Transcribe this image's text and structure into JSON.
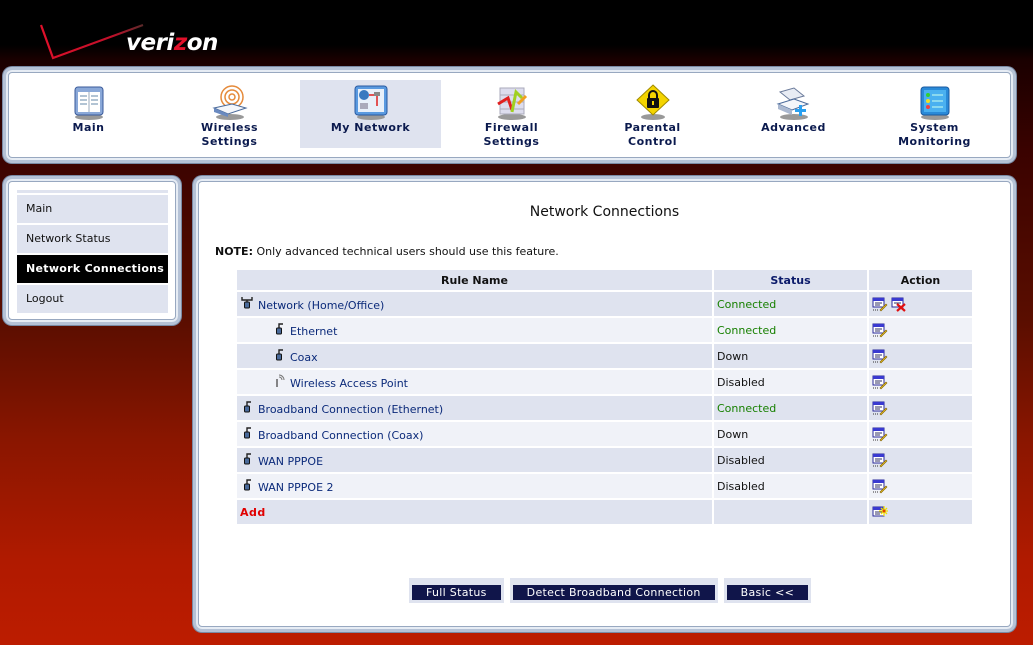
{
  "brand": {
    "logo_prefix": "veri",
    "logo_z": "z",
    "logo_suffix": "on"
  },
  "top_nav": [
    {
      "label_line1": "Main",
      "label_line2": "",
      "icon": "main-icon",
      "active": false
    },
    {
      "label_line1": "Wireless",
      "label_line2": "Settings",
      "icon": "wireless-icon",
      "active": false
    },
    {
      "label_line1": "My Network",
      "label_line2": "",
      "icon": "network-icon",
      "active": true
    },
    {
      "label_line1": "Firewall",
      "label_line2": "Settings",
      "icon": "firewall-icon",
      "active": false
    },
    {
      "label_line1": "Parental",
      "label_line2": "Control",
      "icon": "lock-icon",
      "active": false
    },
    {
      "label_line1": "Advanced",
      "label_line2": "",
      "icon": "advanced-icon",
      "active": false
    },
    {
      "label_line1": "System",
      "label_line2": "Monitoring",
      "icon": "monitoring-icon",
      "active": false
    }
  ],
  "sidebar": {
    "items": [
      {
        "label": "Main",
        "active": false
      },
      {
        "label": "Network Status",
        "active": false
      },
      {
        "label": "Network Connections",
        "active": true
      },
      {
        "label": "Logout",
        "active": false
      }
    ]
  },
  "main": {
    "title": "Network Connections",
    "note_label": "NOTE:",
    "note_text": " Only advanced technical users should use this feature.",
    "table": {
      "headers": {
        "name": "Rule Name",
        "status": "Status",
        "action": "Action"
      },
      "rows": [
        {
          "name": "Network (Home/Office)",
          "indent": false,
          "icon": "bridge-icon",
          "status": "Connected",
          "actions": [
            "edit",
            "delete"
          ]
        },
        {
          "name": "Ethernet",
          "indent": true,
          "icon": "ethernet-icon",
          "status": "Connected",
          "actions": [
            "edit"
          ]
        },
        {
          "name": "Coax",
          "indent": true,
          "icon": "ethernet-icon",
          "status": "Down",
          "actions": [
            "edit"
          ]
        },
        {
          "name": "Wireless Access Point",
          "indent": true,
          "icon": "wireless-ap-icon",
          "status": "Disabled",
          "actions": [
            "edit"
          ]
        },
        {
          "name": "Broadband Connection (Ethernet)",
          "indent": false,
          "icon": "ethernet-icon",
          "status": "Connected",
          "actions": [
            "edit"
          ]
        },
        {
          "name": "Broadband Connection (Coax)",
          "indent": false,
          "icon": "ethernet-icon",
          "status": "Down",
          "actions": [
            "edit"
          ]
        },
        {
          "name": "WAN PPPOE",
          "indent": false,
          "icon": "ethernet-icon",
          "status": "Disabled",
          "actions": [
            "edit"
          ]
        },
        {
          "name": "WAN PPPOE 2",
          "indent": false,
          "icon": "ethernet-icon",
          "status": "Disabled",
          "actions": [
            "edit"
          ]
        }
      ],
      "add_label": "Add"
    },
    "buttons": {
      "full_status": "Full Status",
      "detect": "Detect Broadband Connection",
      "basic": "Basic <<"
    }
  },
  "colors": {
    "connected": "#178000",
    "add": "#e00000",
    "button_bg": "#10154a",
    "row_odd": "#dfe3ef",
    "row_even": "#f0f2f8",
    "link": "#0b2a7a"
  }
}
